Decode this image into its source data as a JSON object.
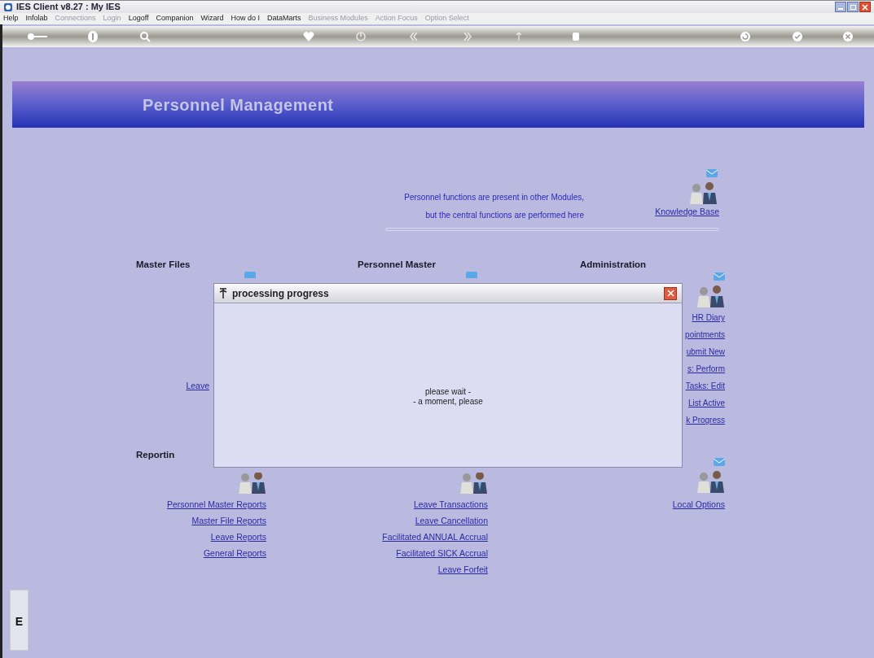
{
  "window": {
    "title": "IES Client v8.27 : My IES"
  },
  "menu": [
    {
      "label": "Help",
      "disabled": false
    },
    {
      "label": "Infolab",
      "disabled": false
    },
    {
      "label": "Connections",
      "disabled": true
    },
    {
      "label": "Login",
      "disabled": true
    },
    {
      "label": "Logoff",
      "disabled": false
    },
    {
      "label": "Companion",
      "disabled": false
    },
    {
      "label": "Wizard",
      "disabled": false
    },
    {
      "label": "How do I",
      "disabled": false
    },
    {
      "label": "DataMarts",
      "disabled": false
    },
    {
      "label": "Business Modules",
      "disabled": true
    },
    {
      "label": "Action Focus",
      "disabled": true
    },
    {
      "label": "Option Select",
      "disabled": true
    }
  ],
  "banner": {
    "title": "Personnel Management"
  },
  "intro": {
    "lines": [
      "Personnel functions are present in other Modules,",
      "but the central functions are performed here"
    ],
    "link": "Knowledge Base"
  },
  "sections": [
    {
      "title": "Master Files",
      "links": [
        "Leave"
      ]
    },
    {
      "title": "Personnel Master"
    },
    {
      "title": "Administration",
      "links": [
        "HR Diary",
        "pointments",
        "ubmit New",
        "s: Perform",
        "Tasks: Edit",
        "List Active",
        "k Progress"
      ]
    }
  ],
  "reporting": {
    "title": "Reportin",
    "columns": [
      {
        "links": [
          "Personnel Master Reports",
          "Master File Reports",
          "Leave Reports",
          "General Reports"
        ]
      },
      {
        "links": [
          "Leave Transactions",
          "Leave Cancellation",
          "Facilitated ANNUAL Accrual",
          "Facilitated SICK Accrual",
          "Leave Forfeit"
        ]
      },
      {
        "links": [
          "Local Options"
        ]
      }
    ]
  },
  "dialog": {
    "title": "processing progress",
    "lines": [
      "please wait -",
      "- a moment, please"
    ]
  },
  "side_tab": {
    "label": "E"
  }
}
